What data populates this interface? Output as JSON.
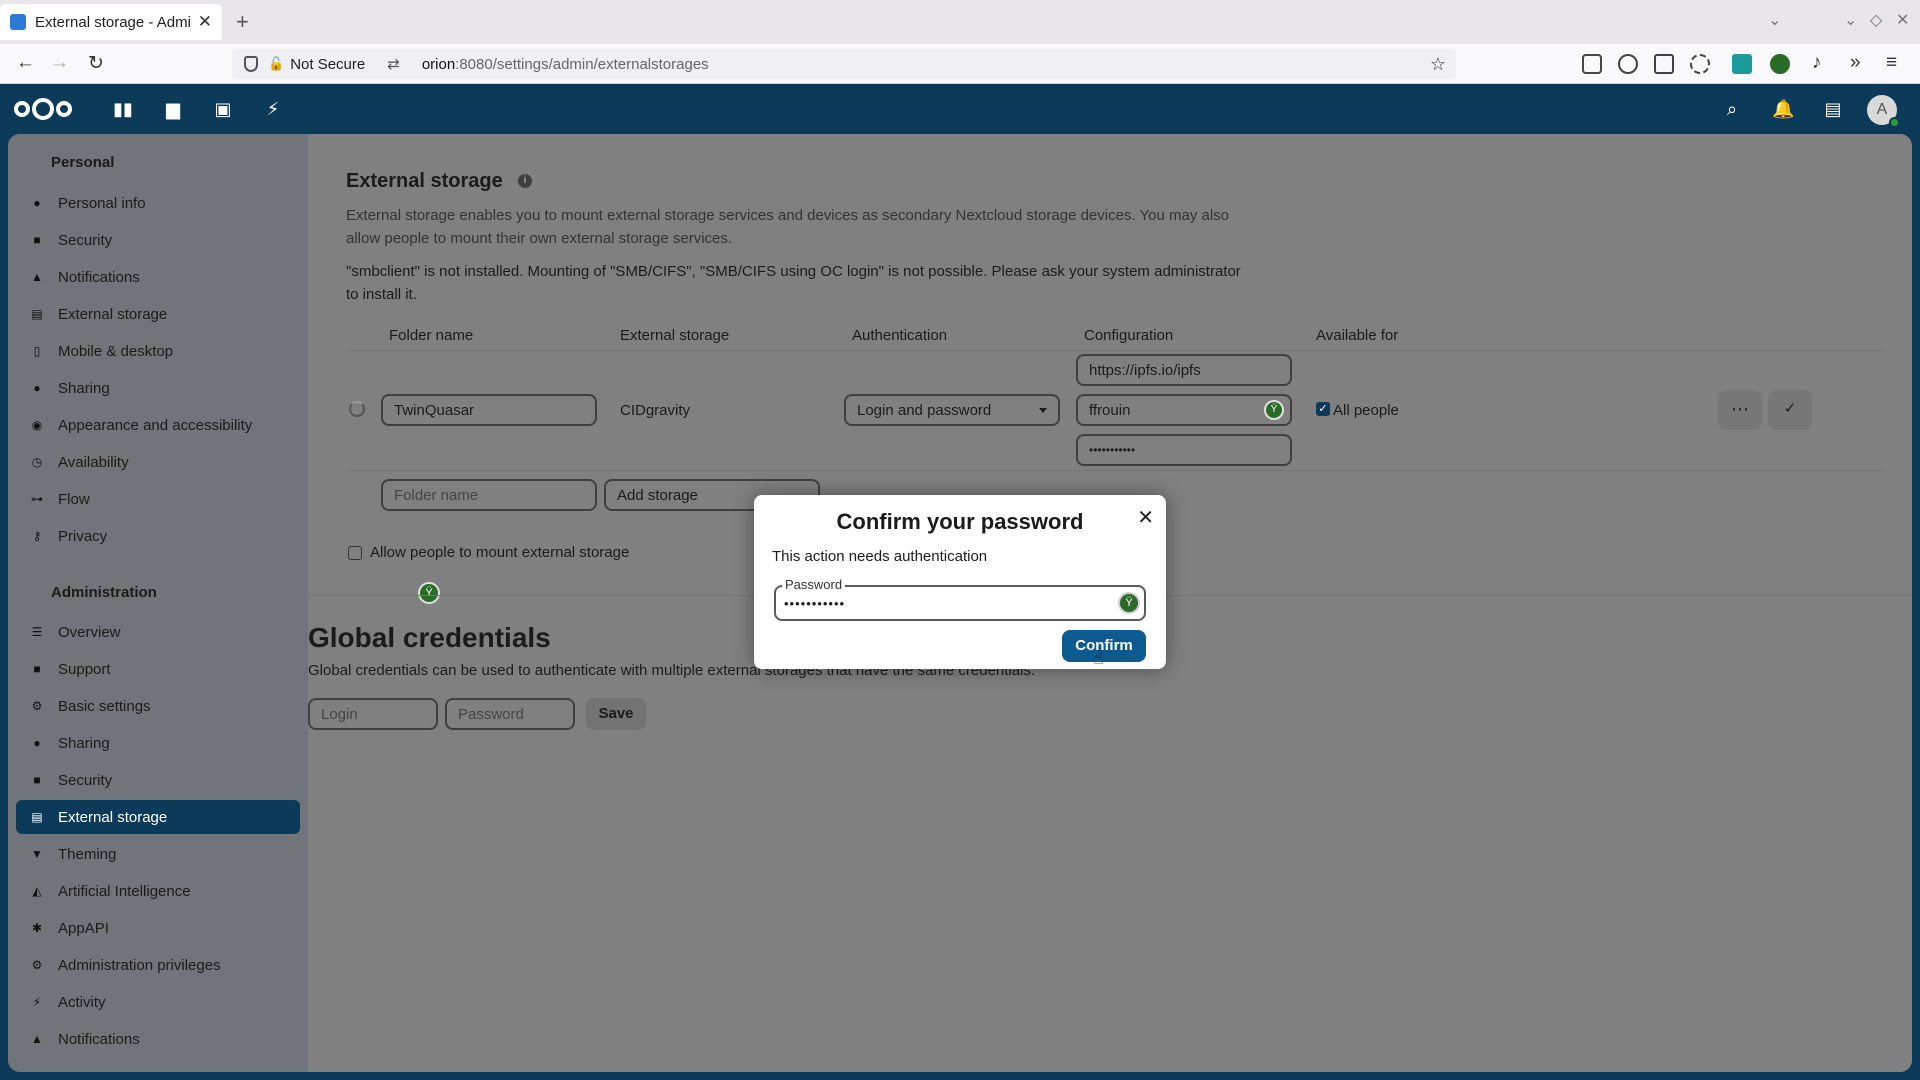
{
  "browser": {
    "tab_title": "External storage - Adminis",
    "not_secure": "Not Secure",
    "url_host": "orion",
    "url_path": ":8080/settings/admin/externalstorages"
  },
  "sidebar": {
    "personal_heading": "Personal",
    "personal": [
      "Personal info",
      "Security",
      "Notifications",
      "External storage",
      "Mobile & desktop",
      "Sharing",
      "Appearance and accessibility",
      "Availability",
      "Flow",
      "Privacy"
    ],
    "admin_heading": "Administration",
    "admin": [
      "Overview",
      "Support",
      "Basic settings",
      "Sharing",
      "Security",
      "External storage",
      "Theming",
      "Artificial Intelligence",
      "AppAPI",
      "Administration privileges",
      "Activity",
      "Notifications"
    ]
  },
  "main": {
    "title": "External storage",
    "description": "External storage enables you to mount external storage services and devices as secondary Nextcloud storage devices. You may also allow people to mount their own external storage services.",
    "warning": "\"smbclient\" is not installed. Mounting of \"SMB/CIFS\", \"SMB/CIFS using OC login\" is not possible. Please ask your system administrator to install it.",
    "columns": {
      "folder": "Folder name",
      "storage": "External storage",
      "auth": "Authentication",
      "config": "Configuration",
      "available": "Available for"
    },
    "row": {
      "folder_value": "TwinQuasar",
      "storage_value": "CIDgravity",
      "auth_value": "Login and password",
      "config_url": "https://ipfs.io/ipfs",
      "config_user": "ffrouin",
      "config_password": "•••••••••••",
      "available_value": "All people"
    },
    "new_row": {
      "folder_placeholder": "Folder name",
      "add_storage": "Add storage"
    },
    "allow_mount_label": "Allow people to mount external storage",
    "global_title": "Global credentials",
    "global_desc": "Global credentials can be used to authenticate with multiple external storages that have the same credentials.",
    "login_placeholder": "Login",
    "password_placeholder": "Password",
    "save": "Save"
  },
  "dialog": {
    "title": "Confirm your password",
    "text": "This action needs authentication",
    "password_label": "Password",
    "password_value": "•••••••••••",
    "confirm": "Confirm"
  }
}
